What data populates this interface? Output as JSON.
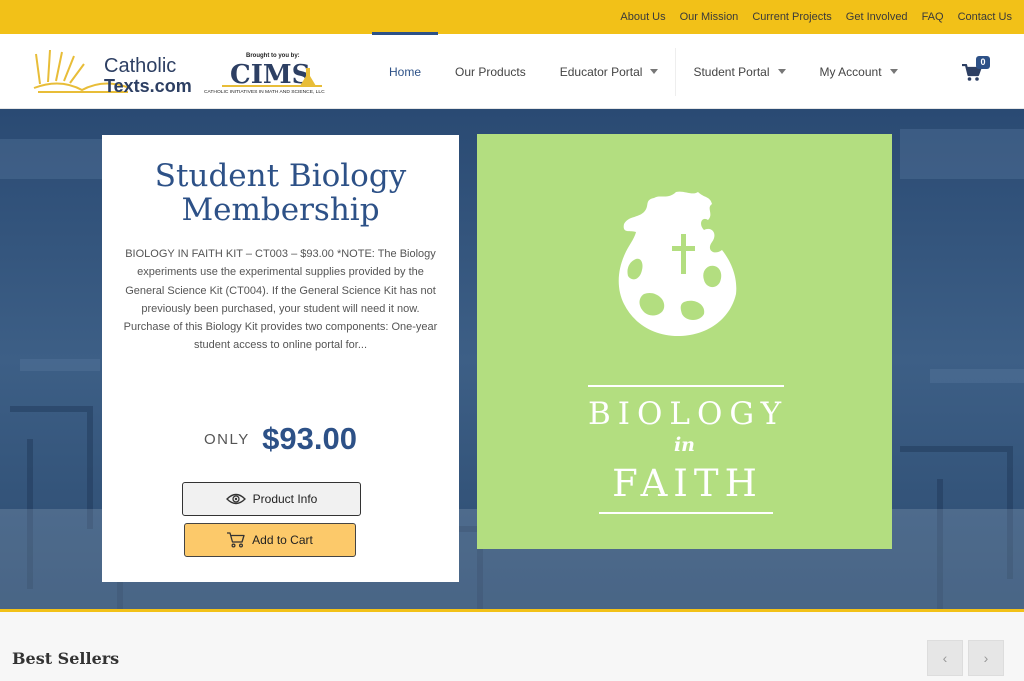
{
  "topbar": {
    "links": [
      "About Us",
      "Our Mission",
      "Current Projects",
      "Get Involved",
      "FAQ",
      "Contact Us"
    ]
  },
  "logos": {
    "catholic_texts_line1": "Catholic",
    "catholic_texts_line2": "Texts.com",
    "cims_tagline": "Brought to you by:",
    "cims_name": "CIMS",
    "cims_full": "CATHOLIC INITIATIVES IN MATH AND SCIENCE, LLC"
  },
  "nav": {
    "home": "Home",
    "products": "Our Products",
    "educator": "Educator Portal",
    "student": "Student Portal",
    "account": "My Account",
    "cart_count": "0"
  },
  "product": {
    "title": "Student Biology Membership",
    "description": "BIOLOGY IN FAITH KIT – CT003 –  $93.00 *NOTE:  The Biology experiments use the experimental supplies provided by the General Science Kit (CT004).  If the General Science Kit has not previously been purchased, your student will need it now. Purchase of this Biology Kit provides two components:  One-year student access to online portal for...",
    "price_prefix": "ONLY",
    "price": "$93.00",
    "info_button": "Product Info",
    "cart_button": "Add to Cart",
    "image_word1": "BIOLOGY",
    "image_word2": "in",
    "image_word3": "FAITH"
  },
  "best_sellers": {
    "title": "Best Sellers",
    "prev": "‹",
    "next": "›"
  },
  "colors": {
    "topbar": "#f2c118",
    "brand_blue": "#2d5187",
    "product_green": "#b3de80",
    "cart_button": "#fcc96a"
  },
  "icons": [
    "cart-icon",
    "eye-icon",
    "globe-cross-icon",
    "chevron-left-icon",
    "chevron-right-icon"
  ]
}
